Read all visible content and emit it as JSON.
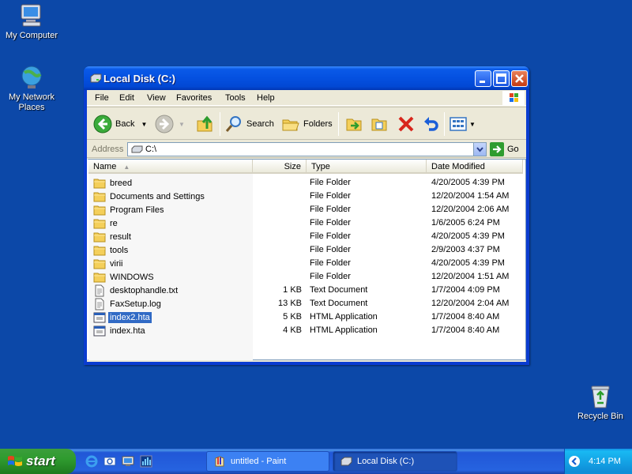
{
  "desktop": {
    "icons": [
      {
        "label": "My Computer"
      },
      {
        "label": "My Network Places"
      },
      {
        "label": "Recycle Bin"
      }
    ]
  },
  "window": {
    "title": "Local Disk (C:)",
    "menu": [
      "File",
      "Edit",
      "View",
      "Favorites",
      "Tools",
      "Help"
    ],
    "toolbar": {
      "back": "Back",
      "search": "Search",
      "folders": "Folders"
    },
    "address": {
      "label": "Address",
      "value": "C:\\",
      "go": "Go"
    },
    "columns": {
      "name": "Name",
      "size": "Size",
      "type": "Type",
      "date": "Date Modified"
    },
    "files": [
      {
        "name": "breed",
        "size": "",
        "type": "File Folder",
        "date": "4/20/2005 4:39 PM",
        "icon": "folder-icon"
      },
      {
        "name": "Documents and Settings",
        "size": "",
        "type": "File Folder",
        "date": "12/20/2004 1:54 AM",
        "icon": "folder-icon"
      },
      {
        "name": "Program Files",
        "size": "",
        "type": "File Folder",
        "date": "12/20/2004 2:06 AM",
        "icon": "folder-icon"
      },
      {
        "name": "re",
        "size": "",
        "type": "File Folder",
        "date": "1/6/2005 6:24 PM",
        "icon": "folder-icon"
      },
      {
        "name": "result",
        "size": "",
        "type": "File Folder",
        "date": "4/20/2005 4:39 PM",
        "icon": "folder-icon"
      },
      {
        "name": "tools",
        "size": "",
        "type": "File Folder",
        "date": "2/9/2003 4:37 PM",
        "icon": "folder-icon"
      },
      {
        "name": "virii",
        "size": "",
        "type": "File Folder",
        "date": "4/20/2005 4:39 PM",
        "icon": "folder-icon"
      },
      {
        "name": "WINDOWS",
        "size": "",
        "type": "File Folder",
        "date": "12/20/2004 1:51 AM",
        "icon": "folder-icon"
      },
      {
        "name": "desktophandle.txt",
        "size": "1 KB",
        "type": "Text Document",
        "date": "1/7/2004 4:09 PM",
        "icon": "text-file-icon"
      },
      {
        "name": "FaxSetup.log",
        "size": "13 KB",
        "type": "Text Document",
        "date": "12/20/2004 2:04 AM",
        "icon": "text-file-icon"
      },
      {
        "name": "index2.hta",
        "size": "5 KB",
        "type": "HTML Application",
        "date": "1/7/2004 8:40 AM",
        "icon": "hta-file-icon",
        "selected": true
      },
      {
        "name": "index.hta",
        "size": "4 KB",
        "type": "HTML Application",
        "date": "1/7/2004 8:40 AM",
        "icon": "hta-file-icon"
      }
    ]
  },
  "taskbar": {
    "start": "start",
    "tasks": [
      {
        "label": "untitled - Paint",
        "active": false
      },
      {
        "label": "Local Disk (C:)",
        "active": true
      }
    ],
    "clock": "4:14 PM"
  },
  "colors": {
    "desktop": "#0C48A8",
    "titlebar": "#0450E0",
    "selection": "#316AC5",
    "start": "#2F9B2F"
  }
}
